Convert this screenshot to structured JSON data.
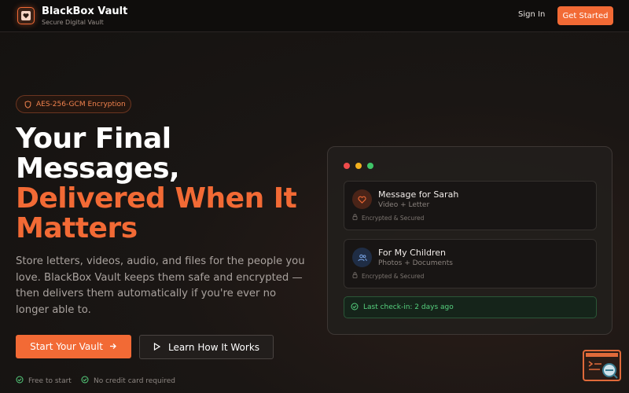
{
  "header": {
    "brand_name": "BlackBox Vault",
    "brand_tagline": "Secure Digital Vault",
    "sign_in": "Sign In",
    "get_started": "Get Started"
  },
  "hero": {
    "badge": "AES-256-GCM Encryption",
    "headline_line1": "Your Final",
    "headline_line2": "Messages,",
    "headline_line3": "Delivered When It",
    "headline_line4": "Matters",
    "description": "Store letters, videos, audio, and files for the people you love. BlackBox Vault keeps them safe and encrypted — then delivers them automatically if you're ever no longer able to.",
    "primary_button": "Start Your Vault",
    "secondary_button": "Learn How It Works",
    "perks": [
      "Free to start",
      "No credit card required"
    ]
  },
  "preview_card": {
    "messages": [
      {
        "title": "Message for Sarah",
        "subtitle": "Video + Letter",
        "status": "Encrypted & Secured",
        "icon": "heart-icon"
      },
      {
        "title": "For My Children",
        "subtitle": "Photos + Documents",
        "status": "Encrypted & Secured",
        "icon": "users-icon"
      }
    ],
    "checkin": "Last check-in: 2 days ago"
  },
  "colors": {
    "accent": "#f26a35",
    "success": "#56d07e",
    "background": "#141210"
  }
}
